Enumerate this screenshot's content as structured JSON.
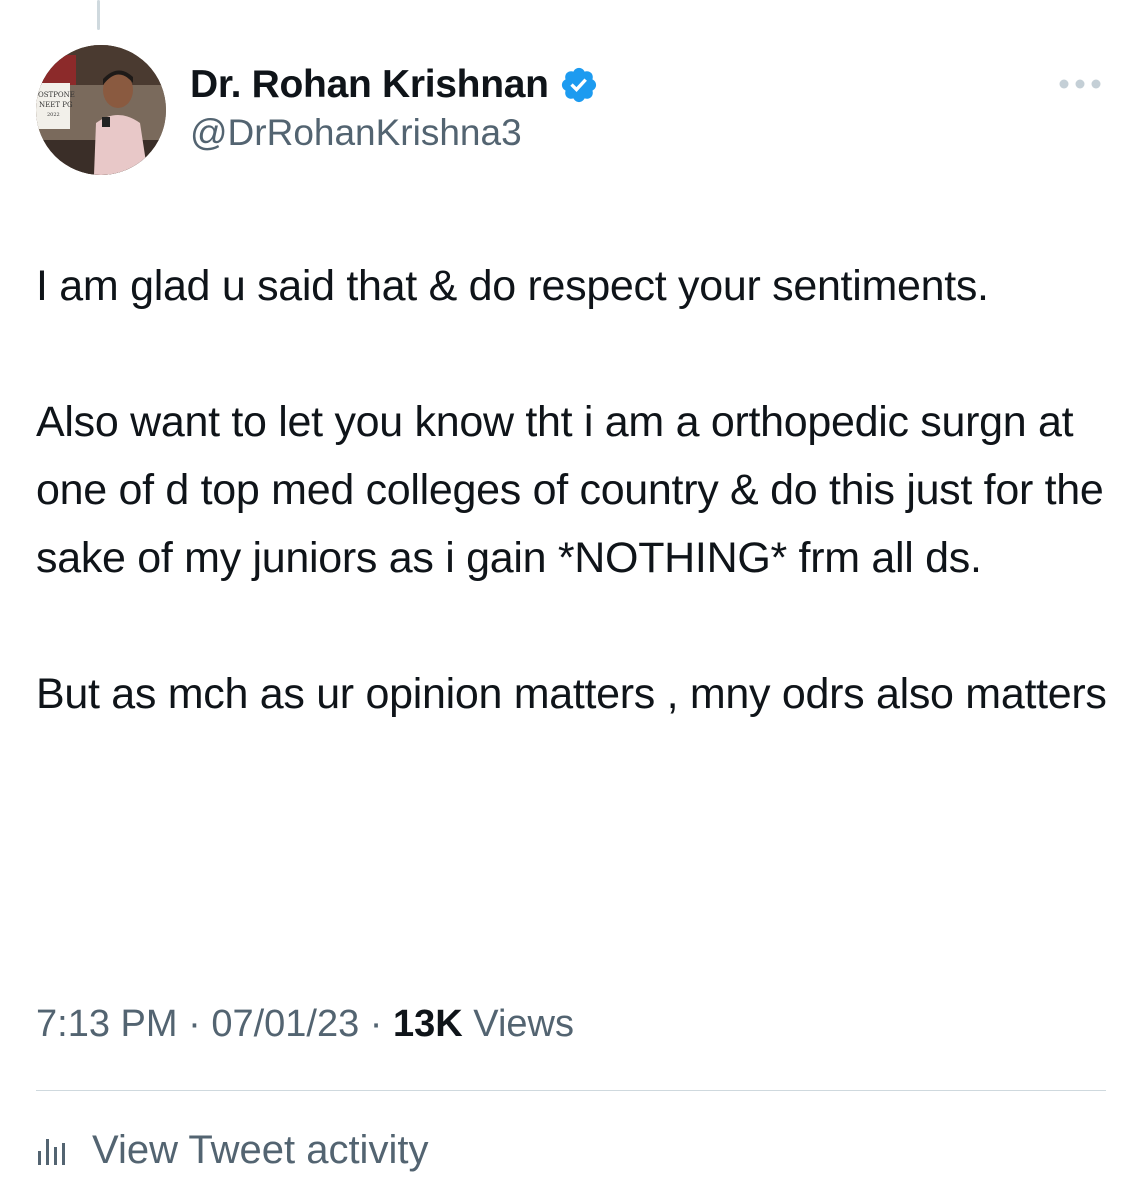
{
  "author": {
    "display_name": "Dr. Rohan Krishnan",
    "handle": "@DrRohanKrishna3",
    "avatar_sign_lines": [
      "OSTPONE",
      "NEET PG",
      "2022"
    ]
  },
  "tweet": {
    "paragraphs": [
      "I am glad u said that & do respect your sentiments.",
      "Also want to let you know tht i am a orthopedic surgn at one of d top med colleges of country & do this just for the sake of my juniors as i gain *NOTHING* frm all ds.",
      "But as mch as ur opinion matters , mny odrs also matters"
    ],
    "time": "7:13 PM",
    "date": "07/01/23",
    "separator": " · ",
    "views_count": "13K",
    "views_label": "Views"
  },
  "actions": {
    "activity_label": "View Tweet activity"
  },
  "icons": {
    "verified": "verified-badge-icon",
    "more": "more-options-icon",
    "activity": "bar-chart-icon"
  },
  "colors": {
    "text_primary": "#0f1419",
    "text_secondary": "#536471",
    "verified_blue": "#1d9bf0",
    "divider": "#cfd9de"
  }
}
